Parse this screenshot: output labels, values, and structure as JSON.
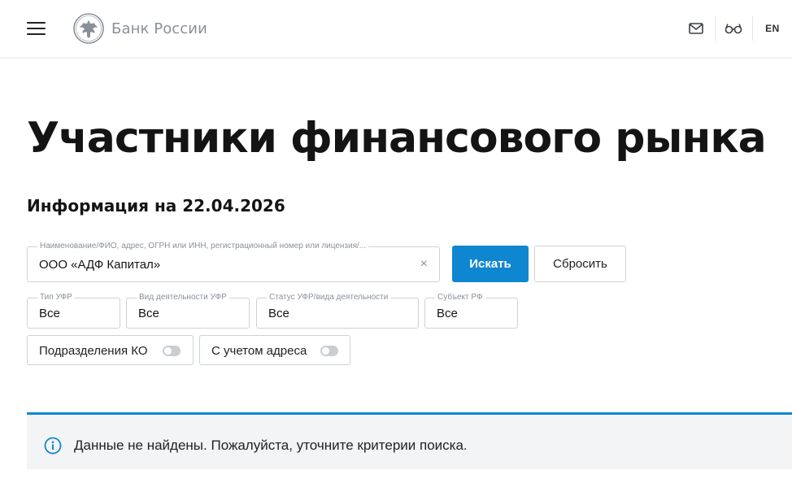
{
  "header": {
    "logo_text": "Банк России",
    "lang_label": "EN",
    "icons": {
      "menu": "hamburger-menu-icon",
      "emblem": "double-headed-eagle-emblem",
      "mail": "mail-icon",
      "accessibility": "glasses-icon"
    }
  },
  "page": {
    "title": "Участники финансового рынка",
    "info_date": "Информация на 22.04.2026"
  },
  "search": {
    "label": "Наименование/ФИО, адрес, ОГРН или ИНН, регистрационный номер или лицензия/...",
    "value": "ООО «АДФ Капитал»",
    "clear_symbol": "×",
    "search_button": "Искать",
    "reset_button": "Сбросить"
  },
  "filters": [
    {
      "label": "Тип УФР",
      "value": "Все"
    },
    {
      "label": "Вид деятельности УФР",
      "value": "Все"
    },
    {
      "label": "Статус УФР/вида деятельности",
      "value": "Все"
    },
    {
      "label": "Субъект РФ",
      "value": "Все"
    }
  ],
  "toggles": [
    {
      "label": "Подразделения КО",
      "on": false
    },
    {
      "label": "С учетом адреса",
      "on": false
    }
  ],
  "notice": {
    "text": "Данные не найдены. Пожалуйста, уточните критерии поиска.",
    "icon": "info-circle-icon"
  },
  "colors": {
    "accent": "#0f86d0",
    "border": "#cdd2d7",
    "notice_bg": "#f3f4f6",
    "logo_gray": "#8a9099"
  }
}
